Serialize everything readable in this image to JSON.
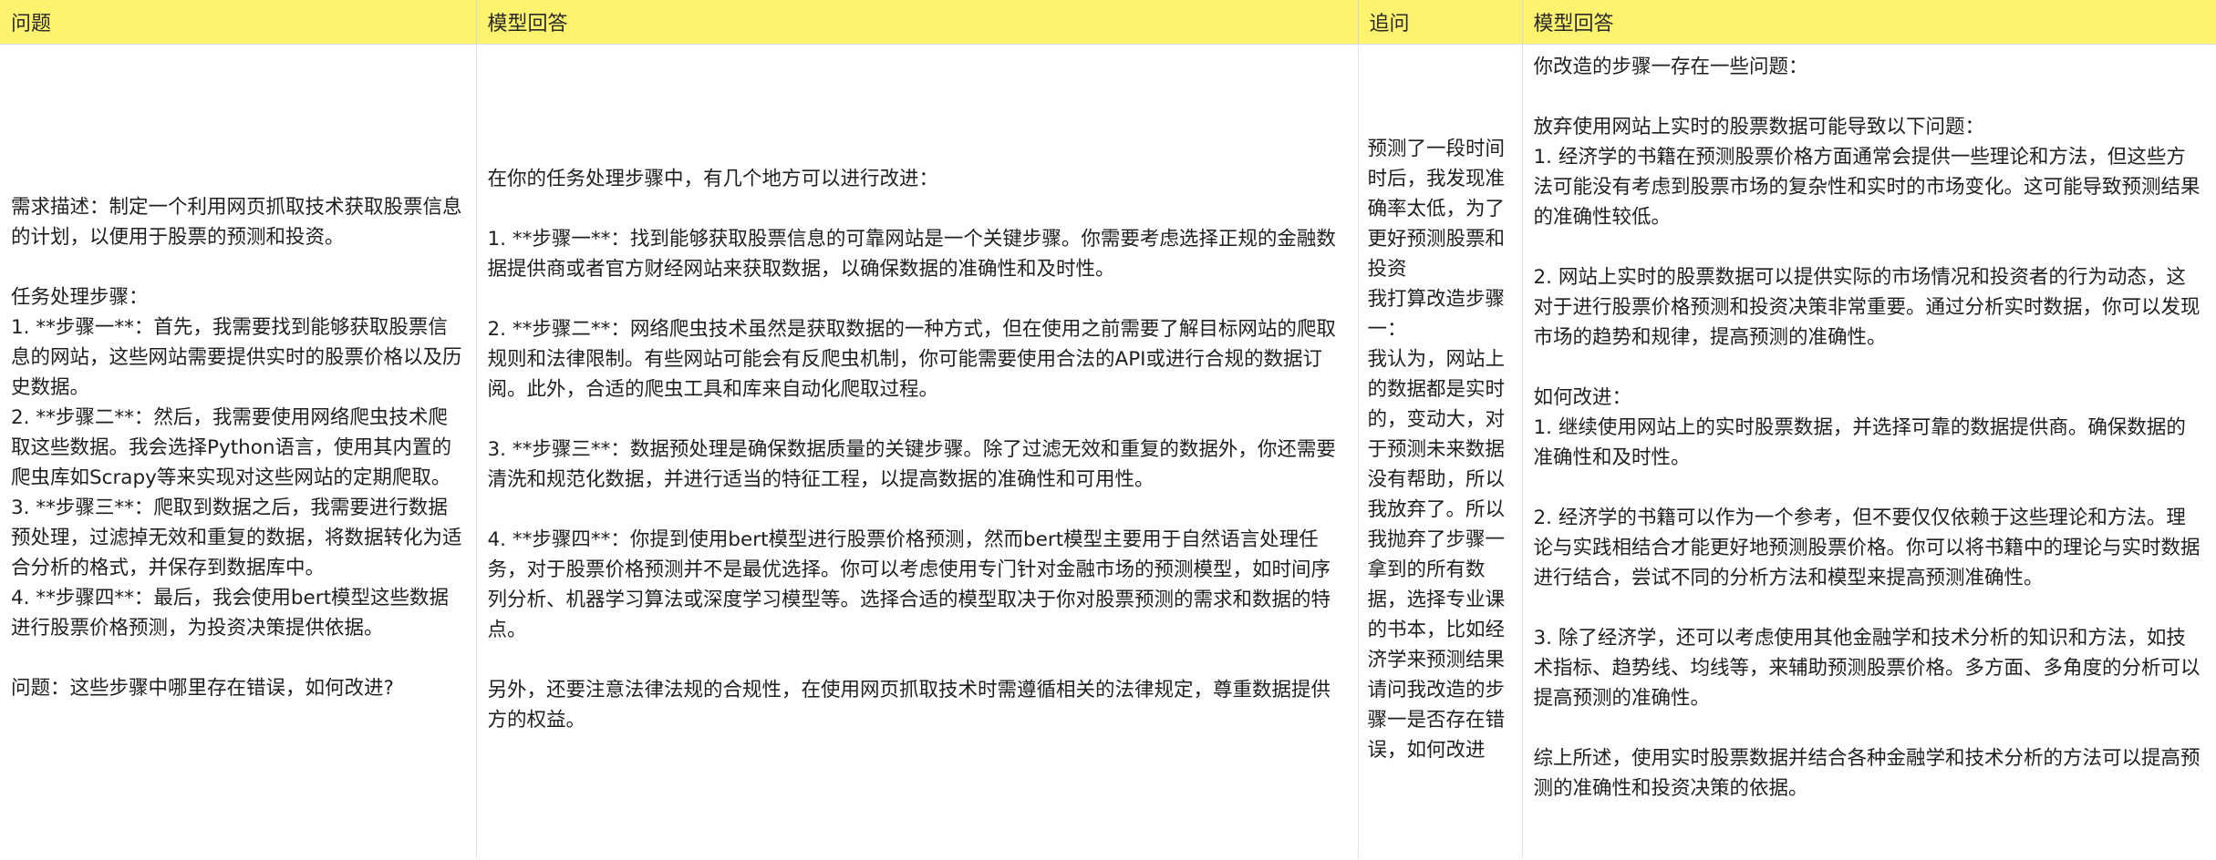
{
  "header": {
    "col1": "问题",
    "col2": "模型回答",
    "col3": "追问",
    "col4": "模型回答"
  },
  "row": {
    "question": "需求描述：制定一个利用网页抓取技术获取股票信息的计划，以便用于股票的预测和投资。\n\n任务处理步骤：\n1. **步骤一**：首先，我需要找到能够获取股票信息的网站，这些网站需要提供实时的股票价格以及历史数据。\n2. **步骤二**：然后，我需要使用网络爬虫技术爬取这些数据。我会选择Python语言，使用其内置的爬虫库如Scrapy等来实现对这些网站的定期爬取。\n3. **步骤三**：爬取到数据之后，我需要进行数据预处理，过滤掉无效和重复的数据，将数据转化为适合分析的格式，并保存到数据库中。\n4. **步骤四**：最后，我会使用bert模型这些数据进行股票价格预测，为投资决策提供依据。\n\n问题：这些步骤中哪里存在错误，如何改进?",
    "answer_1": "在你的任务处理步骤中，有几个地方可以进行改进：\n\n1. **步骤一**：找到能够获取股票信息的可靠网站是一个关键步骤。你需要考虑选择正规的金融数据提供商或者官方财经网站来获取数据，以确保数据的准确性和及时性。\n\n2. **步骤二**：网络爬虫技术虽然是获取数据的一种方式，但在使用之前需要了解目标网站的爬取规则和法律限制。有些网站可能会有反爬虫机制，你可能需要使用合法的API或进行合规的数据订阅。此外，合适的爬虫工具和库来自动化爬取过程。\n\n3. **步骤三**：数据预处理是确保数据质量的关键步骤。除了过滤无效和重复的数据外，你还需要清洗和规范化数据，并进行适当的特征工程，以提高数据的准确性和可用性。\n\n4. **步骤四**：你提到使用bert模型进行股票价格预测，然而bert模型主要用于自然语言处理任务，对于股票价格预测并不是最优选择。你可以考虑使用专门针对金融市场的预测模型，如时间序列分析、机器学习算法或深度学习模型等。选择合适的模型取决于你对股票预测的需求和数据的特点。\n\n另外，还要注意法律法规的合规性，在使用网页抓取技术时需遵循相关的法律规定，尊重数据提供方的权益。",
    "followup": "预测了一段时间时后，我发现准确率太低，为了更好预测股票和投资\n我打算改造步骤一：\n我认为，网站上的数据都是实时的，变动大，对于预测未来数据没有帮助，所以我放弃了。所以我抛弃了步骤一拿到的所有数据，选择专业课的书本，比如经济学来预测结果\n请问我改造的步骤一是否存在错误，如何改进",
    "answer_2": "你改造的步骤一存在一些问题：\n\n放弃使用网站上实时的股票数据可能导致以下问题：\n1. 经济学的书籍在预测股票价格方面通常会提供一些理论和方法，但这些方法可能没有考虑到股票市场的复杂性和实时的市场变化。这可能导致预测结果的准确性较低。\n\n2. 网站上实时的股票数据可以提供实际的市场情况和投资者的行为动态，这对于进行股票价格预测和投资决策非常重要。通过分析实时数据，你可以发现市场的趋势和规律，提高预测的准确性。\n\n如何改进：\n1. 继续使用网站上的实时股票数据，并选择可靠的数据提供商。确保数据的准确性和及时性。\n\n2. 经济学的书籍可以作为一个参考，但不要仅仅依赖于这些理论和方法。理论与实践相结合才能更好地预测股票价格。你可以将书籍中的理论与实时数据进行结合，尝试不同的分析方法和模型来提高预测准确性。\n\n3. 除了经济学，还可以考虑使用其他金融学和技术分析的知识和方法，如技术指标、趋势线、均线等，来辅助预测股票价格。多方面、多角度的分析可以提高预测的准确性。\n\n综上所述，使用实时股票数据并结合各种金融学和技术分析的方法可以提高预测的准确性和投资决策的依据。"
  }
}
